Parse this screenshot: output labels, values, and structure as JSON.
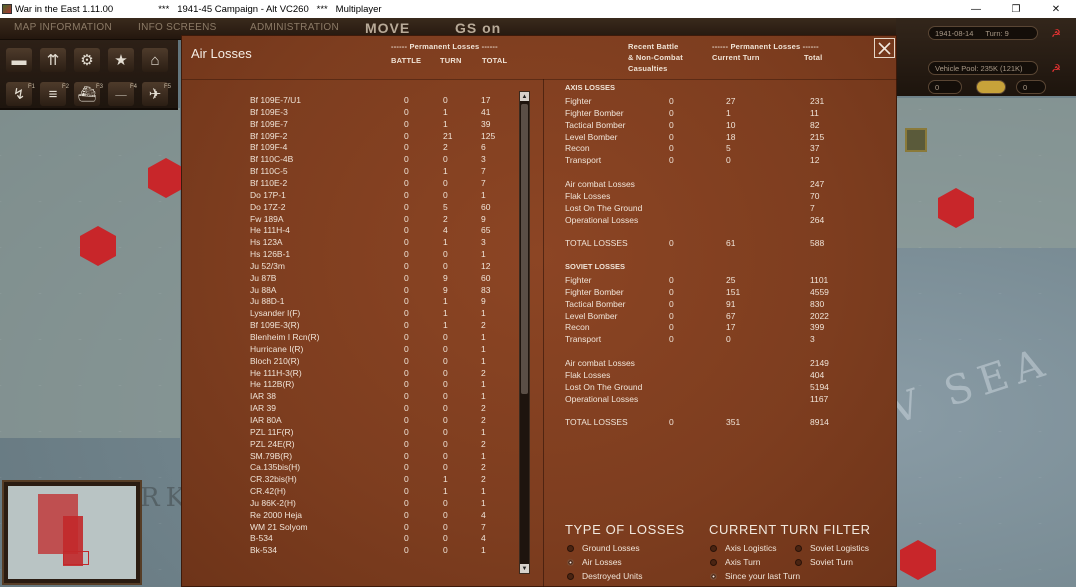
{
  "window": {
    "title": "War in the East 1.11.00",
    "subtitle": "***   1941-45 Campaign - Alt VC260   ***   Multiplayer",
    "controls": [
      "—",
      "❐",
      "✕"
    ]
  },
  "toolbar": {
    "tabs": [
      "MAP INFORMATION",
      "INFO SCREENS",
      "ADMINISTRATION"
    ],
    "mode": "MOVE",
    "mode2": "GS on",
    "fkeys": [
      "F1",
      "F2",
      "F3",
      "F4",
      "F5"
    ]
  },
  "status": {
    "date": "1941-08-14",
    "turn": "Turn: 9",
    "vehicle_pool": "Vehicle Pool: 235K (121K)",
    "field_zero": "0",
    "field_zero2": "0"
  },
  "dialog": {
    "title": "Air Losses",
    "close_icon": "close-icon",
    "headers": {
      "perm_losses_left": "------ Permanent Losses ------",
      "battle": "BATTLE",
      "turn": "TURN",
      "total": "TOTAL",
      "recent_battle_1": "Recent Battle",
      "recent_battle_2": "& Non-Combat",
      "recent_battle_3": "Casualties",
      "perm_losses_right": "------ Permanent Losses ------",
      "current_turn": "Current Turn",
      "total_right": "Total"
    },
    "aircraft": [
      [
        "Bf 109E-7/U1",
        "0",
        "0",
        "17"
      ],
      [
        "Bf 109E-3",
        "0",
        "1",
        "41"
      ],
      [
        "Bf 109E-7",
        "0",
        "1",
        "39"
      ],
      [
        "Bf 109F-2",
        "0",
        "21",
        "125"
      ],
      [
        "Bf 109F-4",
        "0",
        "2",
        "6"
      ],
      [
        "Bf 110C-4B",
        "0",
        "0",
        "3"
      ],
      [
        "Bf 110C-5",
        "0",
        "1",
        "7"
      ],
      [
        "Bf 110E-2",
        "0",
        "0",
        "7"
      ],
      [
        "Do 17P-1",
        "0",
        "0",
        "1"
      ],
      [
        "Do 17Z-2",
        "0",
        "5",
        "60"
      ],
      [
        "Fw 189A",
        "0",
        "2",
        "9"
      ],
      [
        "He 111H-4",
        "0",
        "4",
        "65"
      ],
      [
        "Hs 123A",
        "0",
        "1",
        "3"
      ],
      [
        "Hs 126B-1",
        "0",
        "0",
        "1"
      ],
      [
        "Ju 52/3m",
        "0",
        "0",
        "12"
      ],
      [
        "Ju 87B",
        "0",
        "9",
        "60"
      ],
      [
        "Ju 88A",
        "0",
        "9",
        "83"
      ],
      [
        "Ju 88D-1",
        "0",
        "1",
        "9"
      ],
      [
        "Lysander I(F)",
        "0",
        "1",
        "1"
      ],
      [
        "Bf 109E-3(R)",
        "0",
        "1",
        "2"
      ],
      [
        "Blenheim I Rcn(R)",
        "0",
        "0",
        "1"
      ],
      [
        "Hurricane I(R)",
        "0",
        "0",
        "1"
      ],
      [
        "Bloch 210(R)",
        "0",
        "0",
        "1"
      ],
      [
        "He 111H-3(R)",
        "0",
        "0",
        "2"
      ],
      [
        "He 112B(R)",
        "0",
        "0",
        "1"
      ],
      [
        "IAR 38",
        "0",
        "0",
        "1"
      ],
      [
        "IAR 39",
        "0",
        "0",
        "2"
      ],
      [
        "IAR 80A",
        "0",
        "0",
        "2"
      ],
      [
        "PZL 11F(R)",
        "0",
        "0",
        "1"
      ],
      [
        "PZL 24E(R)",
        "0",
        "0",
        "2"
      ],
      [
        "SM.79B(R)",
        "0",
        "0",
        "1"
      ],
      [
        "Ca.135bis(H)",
        "0",
        "0",
        "2"
      ],
      [
        "CR.32bis(H)",
        "0",
        "1",
        "2"
      ],
      [
        "CR.42(H)",
        "0",
        "1",
        "1"
      ],
      [
        "Ju 86K-2(H)",
        "0",
        "0",
        "1"
      ],
      [
        "Re 2000 Heja",
        "0",
        "0",
        "4"
      ],
      [
        "WM 21 Solyom",
        "0",
        "0",
        "7"
      ],
      [
        "B-534",
        "0",
        "0",
        "4"
      ],
      [
        "Bk-534",
        "0",
        "0",
        "1"
      ]
    ],
    "axis": {
      "title": "AXIS LOSSES",
      "rows": [
        [
          "Fighter",
          "0",
          "27",
          "231"
        ],
        [
          "Fighter Bomber",
          "0",
          "1",
          "11"
        ],
        [
          "Tactical Bomber",
          "0",
          "10",
          "82"
        ],
        [
          "Level Bomber",
          "0",
          "18",
          "215"
        ],
        [
          "Recon",
          "0",
          "5",
          "37"
        ],
        [
          "Transport",
          "0",
          "0",
          "12"
        ]
      ],
      "summary": [
        [
          "Air combat Losses",
          "247"
        ],
        [
          "Flak Losses",
          "70"
        ],
        [
          "Lost On The Ground",
          "7"
        ],
        [
          "Operational Losses",
          "264"
        ]
      ],
      "total": [
        "TOTAL LOSSES",
        "0",
        "61",
        "588"
      ]
    },
    "soviet": {
      "title": "SOVIET LOSSES",
      "rows": [
        [
          "Fighter",
          "0",
          "25",
          "1101"
        ],
        [
          "Fighter Bomber",
          "0",
          "151",
          "4559"
        ],
        [
          "Tactical Bomber",
          "0",
          "91",
          "830"
        ],
        [
          "Level Bomber",
          "0",
          "67",
          "2022"
        ],
        [
          "Recon",
          "0",
          "17",
          "399"
        ],
        [
          "Transport",
          "0",
          "0",
          "3"
        ]
      ],
      "summary": [
        [
          "Air combat Losses",
          "2149"
        ],
        [
          "Flak Losses",
          "404"
        ],
        [
          "Lost On The Ground",
          "5194"
        ],
        [
          "Operational Losses",
          "1167"
        ]
      ],
      "total": [
        "TOTAL LOSSES",
        "0",
        "351",
        "8914"
      ]
    },
    "type_of_losses": {
      "title": "TYPE OF LOSSES",
      "options": [
        {
          "label": "Ground Losses",
          "selected": false
        },
        {
          "label": "Air Losses",
          "selected": true
        },
        {
          "label": "Destroyed Units",
          "selected": false
        }
      ]
    },
    "turn_filter": {
      "title": "CURRENT TURN FILTER",
      "options": [
        {
          "label": "Axis Logistics",
          "selected": false
        },
        {
          "label": "Soviet Logistics",
          "selected": false
        },
        {
          "label": "Axis Turn",
          "selected": false
        },
        {
          "label": "Soviet Turn",
          "selected": false
        },
        {
          "label": "Since your last Turn",
          "selected": true
        }
      ]
    }
  },
  "map": {
    "sea_label": "V SEA",
    "sea_label_left": "RK"
  }
}
